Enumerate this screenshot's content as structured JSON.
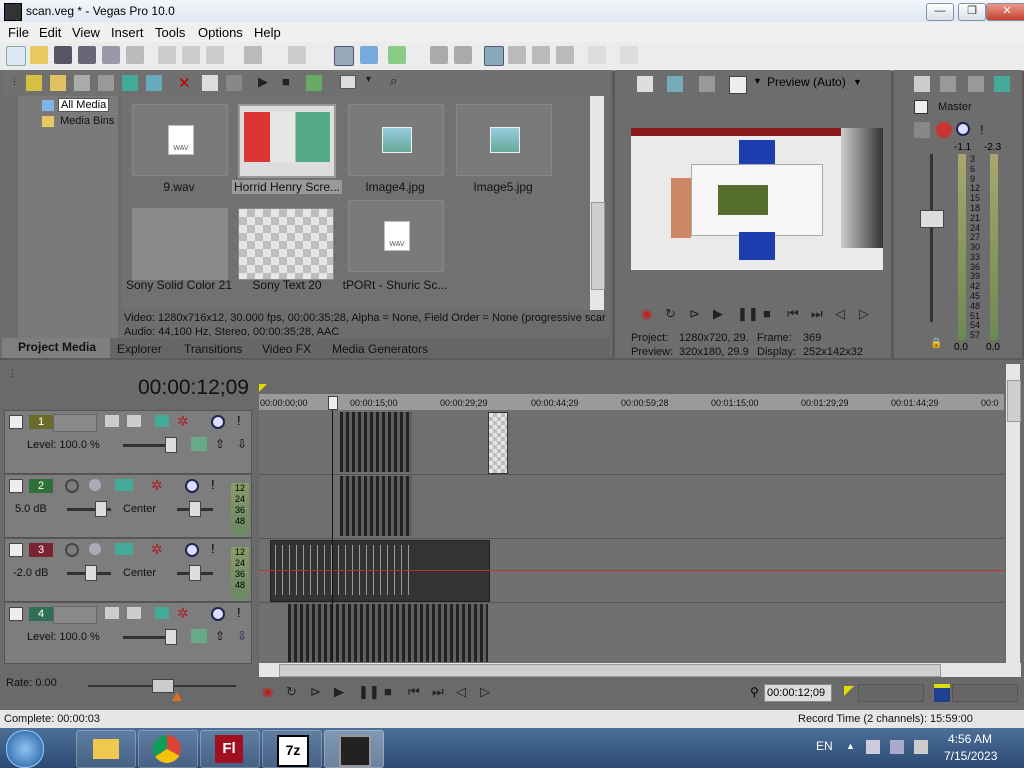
{
  "window": {
    "title": "scan.veg * - Vegas Pro 10.0",
    "min": "—",
    "max": "❐",
    "close": "✕"
  },
  "menu": [
    "File",
    "Edit",
    "View",
    "Insert",
    "Tools",
    "Options",
    "Help"
  ],
  "media": {
    "tree": [
      "All Media",
      "Media Bins"
    ],
    "items": [
      "9.wav",
      "Horrid Henry Scre...",
      "Image4.jpg",
      "Image5.jpg",
      "Sony Solid Color 21",
      "Sony Text 20",
      "tPORt - Shuric Sc..."
    ],
    "wav_badge": "WAV",
    "info_video": "Video: 1280x716x12, 30.000 fps, 00:00:35;28, Alpha = None, Field Order = None (progressive scar",
    "info_audio": "Audio: 44,100 Hz, Stereo, 00:00:35;28, AAC",
    "tabs": [
      "Project Media",
      "Explorer",
      "Transitions",
      "Video FX",
      "Media Generators"
    ]
  },
  "preview": {
    "mode": "Preview (Auto)",
    "project_label": "Project:",
    "project_value": "1280x720, 29.",
    "frame_label": "Frame:",
    "frame_value": "369",
    "preview_label": "Preview:",
    "preview_value": "320x180, 29.9",
    "display_label": "Display:",
    "display_value": "252x142x32"
  },
  "master": {
    "label": "Master",
    "peak_left": "-1.1",
    "peak_right": "-2.3",
    "scale": [
      "3",
      "6",
      "9",
      "12",
      "15",
      "18",
      "21",
      "24",
      "27",
      "30",
      "33",
      "36",
      "39",
      "42",
      "45",
      "48",
      "51",
      "54",
      "57"
    ],
    "bottom_left": "0.0",
    "bottom_right": "0.0"
  },
  "timeline": {
    "timecode": "00:00:12;09",
    "ruler": [
      "00:00:00;00",
      "00:00:15;00",
      "00:00:29;29",
      "00:00:44;29",
      "00:00:59;28",
      "00:01:15;00",
      "00:01:29;29",
      "00:01:44;29",
      "00:0"
    ],
    "tracks": [
      {
        "num": "1",
        "type": "video",
        "info": "Level: 100.0 %"
      },
      {
        "num": "2",
        "type": "audio",
        "info": "5.0 dB",
        "pan": "Center"
      },
      {
        "num": "3",
        "type": "audio",
        "info": "-2.0 dB",
        "pan": "Center"
      },
      {
        "num": "4",
        "type": "video",
        "info": "Level: 100.0 %"
      }
    ],
    "meter_scale": [
      "12",
      "24",
      "36",
      "48"
    ],
    "rate": "Rate: 0.00",
    "bottom_timecode": "00:00:12;09"
  },
  "status": {
    "complete": "Complete: 00:00:03",
    "record_time": "Record Time (2 channels): 15:59:00"
  },
  "taskbar": {
    "lang": "EN",
    "time": "4:56 AM",
    "date": "7/15/2023",
    "apps": [
      "explorer",
      "chrome",
      "Fl",
      "7z",
      "vegas"
    ]
  },
  "colors": {
    "track1": "#6b6b2a",
    "track2": "#2f6f3a",
    "track3": "#7a2433",
    "track4": "#2f6f56",
    "selection": "#1f3f8f"
  }
}
